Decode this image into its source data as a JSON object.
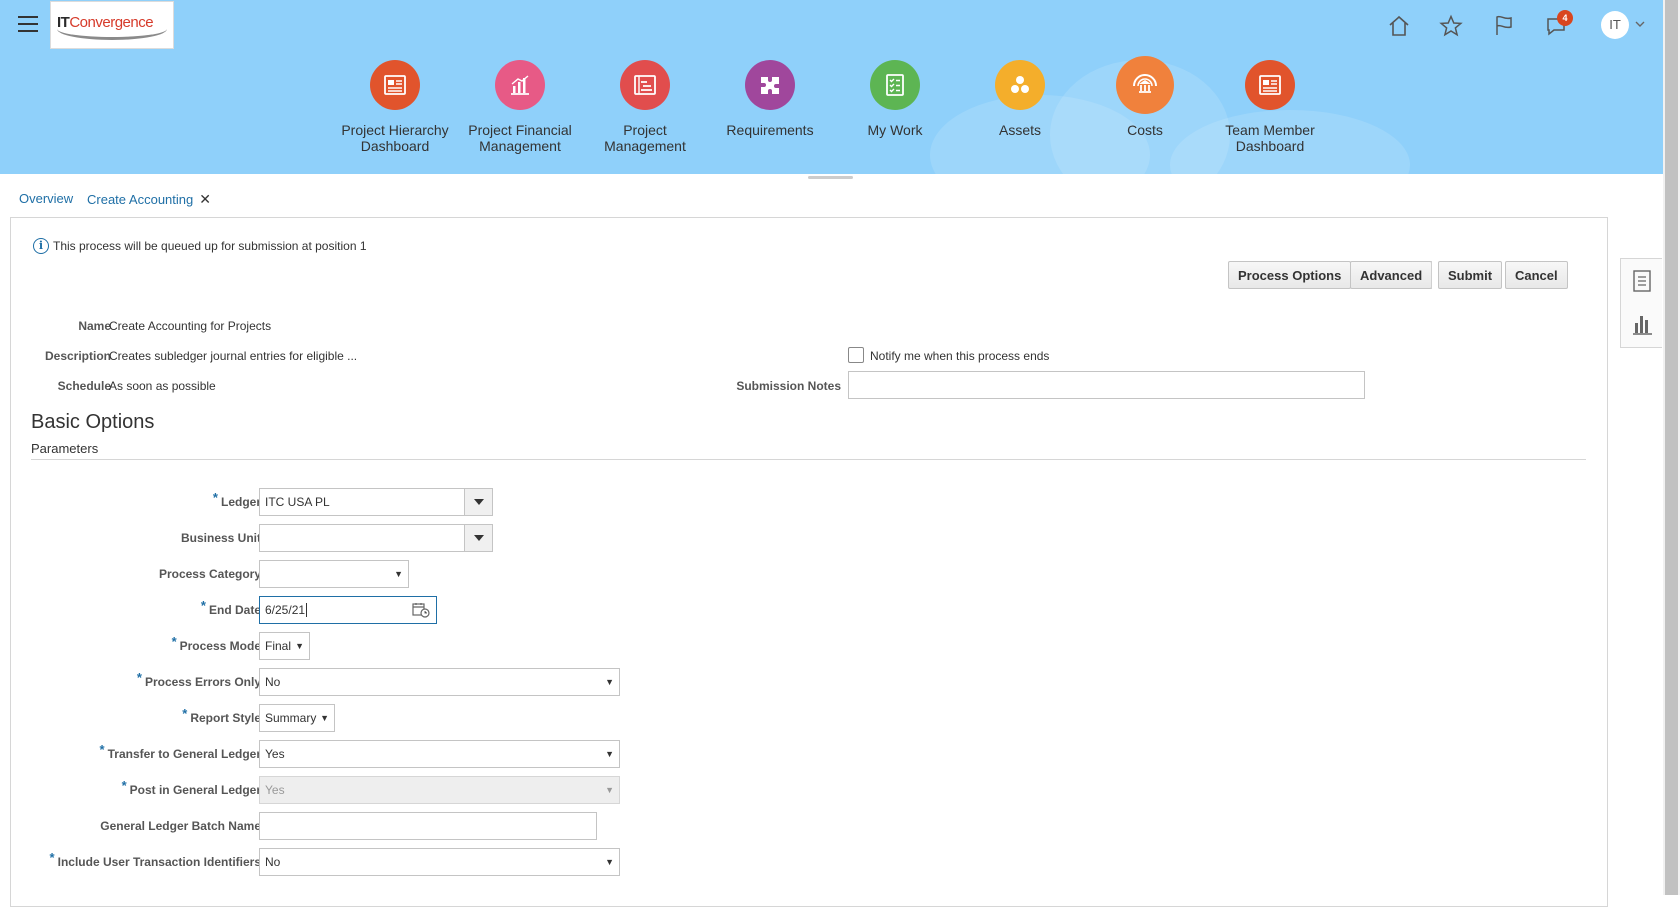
{
  "header": {
    "logo": {
      "it": "IT",
      "rest": "Convergence"
    },
    "notification_count": "4",
    "user_initials": "IT"
  },
  "springboard": [
    {
      "label_line1": "Project Hierarchy",
      "label_line2": "Dashboard",
      "color": "#e1542c",
      "icon": "dashboard-icon"
    },
    {
      "label_line1": "Project Financial",
      "label_line2": "Management",
      "color": "#e75a86",
      "icon": "bar-chart-icon"
    },
    {
      "label_line1": "Project",
      "label_line2": "Management",
      "color": "#e14d4d",
      "icon": "gantt-icon"
    },
    {
      "label_line1": "Requirements",
      "label_line2": "",
      "color": "#a0479c",
      "icon": "puzzle-icon"
    },
    {
      "label_line1": "My Work",
      "label_line2": "",
      "color": "#5db553",
      "icon": "checklist-icon"
    },
    {
      "label_line1": "Assets",
      "label_line2": "",
      "color": "#f4ae2b",
      "icon": "assets-icon"
    },
    {
      "label_line1": "Costs",
      "label_line2": "",
      "color": "#f0813c",
      "icon": "costs-icon"
    },
    {
      "label_line1": "Team Member",
      "label_line2": "Dashboard",
      "color": "#e1542c",
      "icon": "dashboard-icon"
    }
  ],
  "tabs": [
    {
      "label": "Overview"
    },
    {
      "label": "Create Accounting"
    }
  ],
  "info_message": "This process will be queued up for submission at position 1",
  "buttons": {
    "process_options": "Process Options",
    "advanced": "Advanced",
    "submit": "Submit",
    "cancel": "Cancel"
  },
  "summary": {
    "name_label": "Name",
    "name_value": "Create Accounting for Projects",
    "description_label": "Description",
    "description_value": "Creates subledger journal entries for eligible ...",
    "schedule_label": "Schedule",
    "schedule_value": "As soon as possible",
    "notify_label": "Notify me when this process ends",
    "notes_label": "Submission Notes",
    "notes_value": ""
  },
  "section": {
    "title": "Basic Options",
    "subtitle": "Parameters"
  },
  "params": {
    "ledger": {
      "label": "Ledger",
      "value": "ITC USA PL"
    },
    "business_unit": {
      "label": "Business Unit",
      "value": ""
    },
    "process_category": {
      "label": "Process Category",
      "value": ""
    },
    "end_date": {
      "label": "End Date",
      "value": "6/25/21"
    },
    "process_mode": {
      "label": "Process Mode",
      "value": "Final"
    },
    "process_errors_only": {
      "label": "Process Errors Only",
      "value": "No"
    },
    "report_style": {
      "label": "Report Style",
      "value": "Summary"
    },
    "transfer_gl": {
      "label": "Transfer to General Ledger",
      "value": "Yes"
    },
    "post_gl": {
      "label": "Post in General Ledger",
      "value": "Yes"
    },
    "gl_batch_name": {
      "label": "General Ledger Batch Name",
      "value": ""
    },
    "include_uti": {
      "label": "Include User Transaction Identifiers",
      "value": "No"
    }
  },
  "colors": {
    "header_bg": "#8fd0fa",
    "link": "#1f6fa6"
  }
}
